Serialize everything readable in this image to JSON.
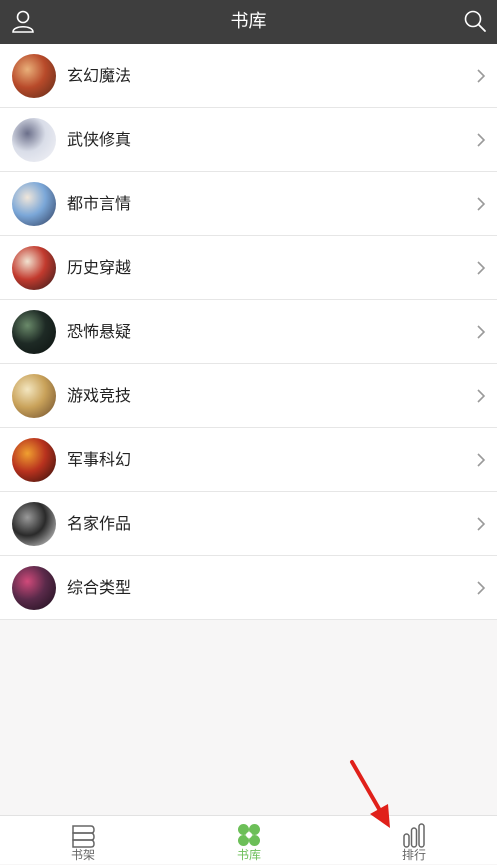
{
  "header": {
    "title": "书库",
    "left_icon": "user-icon",
    "right_icon": "search-icon"
  },
  "categories": [
    {
      "label": "玄幻魔法",
      "colors": [
        "#b84a2a",
        "#e9b07a",
        "#5a2a18"
      ]
    },
    {
      "label": "武侠修真",
      "colors": [
        "#d9dde8",
        "#6b6f8a",
        "#f4f4f8"
      ]
    },
    {
      "label": "都市言情",
      "colors": [
        "#7ba7d8",
        "#f0e6da",
        "#2d3a5a"
      ]
    },
    {
      "label": "历史穿越",
      "colors": [
        "#c23a2e",
        "#f1e2d0",
        "#2a1a1a"
      ]
    },
    {
      "label": "恐怖悬疑",
      "colors": [
        "#1e2a25",
        "#6a8a6a",
        "#0c1210"
      ]
    },
    {
      "label": "游戏竞技",
      "colors": [
        "#c9a25a",
        "#f3e6c0",
        "#6a4a2a"
      ]
    },
    {
      "label": "军事科幻",
      "colors": [
        "#b8321e",
        "#f0a030",
        "#2a0e0a"
      ]
    },
    {
      "label": "名家作品",
      "colors": [
        "#2a2a2a",
        "#9a9a9a",
        "#e8e8e8"
      ]
    },
    {
      "label": "综合类型",
      "colors": [
        "#5a2a4a",
        "#d04a7a",
        "#1a0e1a"
      ]
    }
  ],
  "tabs": [
    {
      "label": "书架",
      "icon": "bookshelf-icon"
    },
    {
      "label": "书库",
      "icon": "library-icon",
      "active": true
    },
    {
      "label": "排行",
      "icon": "ranking-icon"
    }
  ],
  "accent_color": "#6cbf58",
  "annotation_color": "#e0201a"
}
